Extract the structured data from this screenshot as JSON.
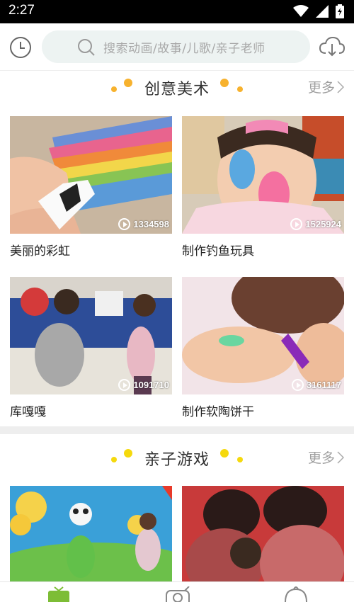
{
  "status": {
    "time": "2:27"
  },
  "search": {
    "placeholder": "搜索动画/故事/儿歌/亲子老师"
  },
  "sections": [
    {
      "title": "创意美术",
      "more": "更多",
      "videos": [
        {
          "title": "美丽的彩虹",
          "views": "1334598"
        },
        {
          "title": "制作钓鱼玩具",
          "views": "1525924"
        },
        {
          "title": "库嘎嘎",
          "views": "1091710"
        },
        {
          "title": "制作软陶饼干",
          "views": "3161117"
        }
      ]
    },
    {
      "title": "亲子游戏",
      "more": "更多",
      "videos": [
        {
          "title": "",
          "views": ""
        },
        {
          "title": "",
          "views": ""
        }
      ]
    }
  ],
  "colors": {
    "accent_dot": "#f7b22e",
    "accent_dot_light": "#f5d90d",
    "nav_active": "#7dbd36"
  },
  "bottom_nav": [
    "tv-icon",
    "camera-icon",
    "baby-icon"
  ]
}
